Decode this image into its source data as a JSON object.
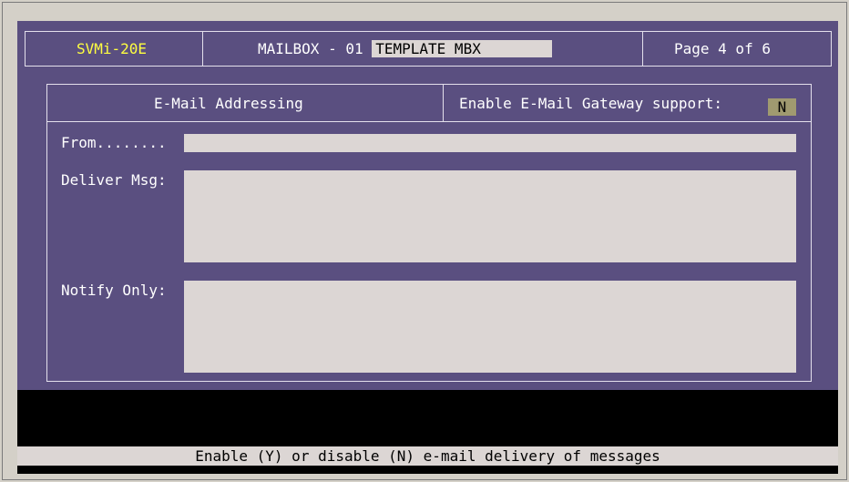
{
  "header": {
    "model": "SVMi-20E",
    "mailbox_label": "MAILBOX - 01",
    "mailbox_name": "TEMPLATE MBX",
    "page": "Page 4 of 6"
  },
  "section": {
    "title": "E-Mail Addressing",
    "gateway_label": "Enable E-Mail Gateway support:",
    "gateway_value": "N"
  },
  "fields": {
    "from_label": "From........",
    "from_value": "",
    "deliver_label": "Deliver Msg:",
    "deliver_value": "",
    "notify_label": "Notify Only:",
    "notify_value": ""
  },
  "status_text": "Enable (Y) or disable (N) e-mail delivery of messages",
  "colors": {
    "screen_bg": "#5a4f80",
    "field_bg": "#dcd6d4",
    "model_text": "#ffff40",
    "gateway_field": "#a09a70"
  }
}
